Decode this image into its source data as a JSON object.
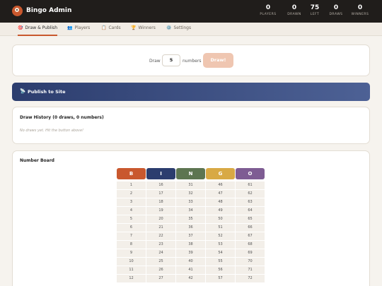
{
  "app": {
    "title": "Bingo Admin"
  },
  "stats": [
    {
      "value": "0",
      "label": "PLAYERS"
    },
    {
      "value": "0",
      "label": "DRAWN"
    },
    {
      "value": "75",
      "label": "LEFT"
    },
    {
      "value": "0",
      "label": "DRAWS"
    },
    {
      "value": "0",
      "label": "WINNERS"
    }
  ],
  "tabs": [
    {
      "icon": "🎯",
      "label": "Draw & Publish",
      "active": true
    },
    {
      "icon": "👥",
      "label": "Players"
    },
    {
      "icon": "📋",
      "label": "Cards"
    },
    {
      "icon": "🏆",
      "label": "Winners"
    },
    {
      "icon": "⚙️",
      "label": "Settings"
    }
  ],
  "draw": {
    "prefix": "Draw",
    "count": "5",
    "suffix": "numbers",
    "button": "Draw!"
  },
  "publish": {
    "icon": "📡",
    "label": "Publish to Site"
  },
  "history": {
    "title": "Draw History (0 draws, 0 numbers)",
    "empty": "No draws yet. Hit the button above!"
  },
  "board": {
    "title": "Number Board",
    "columns": [
      {
        "letter": "B",
        "color": "#c9582e",
        "numbers": [
          "1",
          "2",
          "3",
          "4",
          "5",
          "6",
          "7",
          "8",
          "9",
          "10",
          "11",
          "12"
        ]
      },
      {
        "letter": "I",
        "color": "#2c3d6e",
        "numbers": [
          "16",
          "17",
          "18",
          "19",
          "20",
          "21",
          "22",
          "23",
          "24",
          "25",
          "26",
          "27"
        ]
      },
      {
        "letter": "N",
        "color": "#5d7551",
        "numbers": [
          "31",
          "32",
          "33",
          "34",
          "35",
          "36",
          "37",
          "38",
          "39",
          "40",
          "41",
          "42"
        ]
      },
      {
        "letter": "G",
        "color": "#d8a944",
        "numbers": [
          "46",
          "47",
          "48",
          "49",
          "50",
          "51",
          "52",
          "53",
          "54",
          "55",
          "56",
          "57"
        ]
      },
      {
        "letter": "O",
        "color": "#7e5c93",
        "numbers": [
          "61",
          "62",
          "63",
          "64",
          "65",
          "66",
          "67",
          "68",
          "69",
          "70",
          "71",
          "72"
        ]
      }
    ]
  }
}
